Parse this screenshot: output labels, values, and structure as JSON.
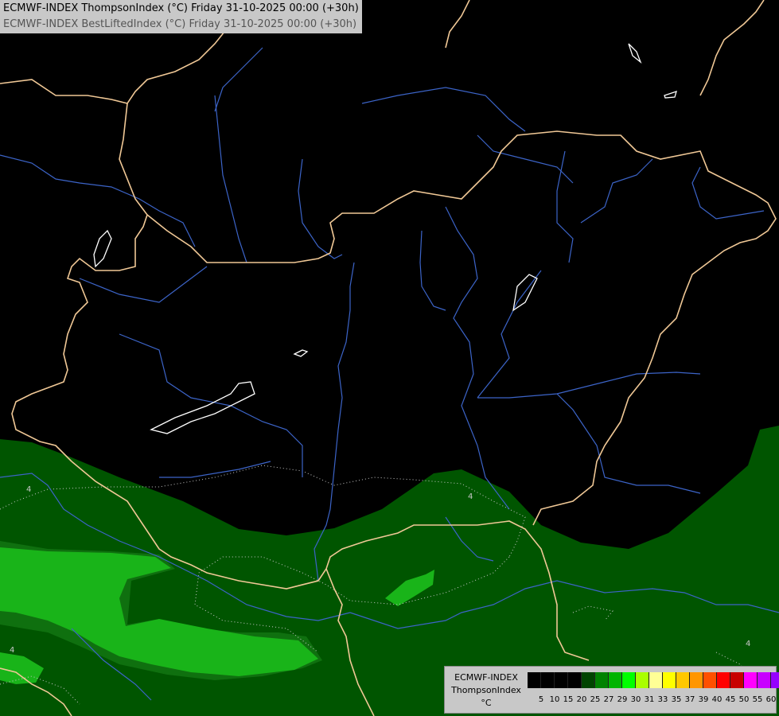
{
  "title": {
    "line1": "ECMWF-INDEX ThompsonIndex (°C) Friday 31-10-2025 00:00 (+30h)",
    "line2": "ECMWF-INDEX BestLiftedIndex (°C) Friday 31-10-2025 00:00 (+30h)"
  },
  "map": {
    "contour_labels": [
      "4",
      "4",
      "4",
      "4"
    ],
    "colors": {
      "background": "#000000",
      "dark_green": "#005500",
      "mid_green": "#008200",
      "bright_green": "#19b419",
      "borders": "#f0c896",
      "rivers": "#3c64c8",
      "lakes": "#ffffff",
      "contours": "#c8c8c8"
    }
  },
  "legend": {
    "line1": "ECMWF-INDEX",
    "line2": "ThompsonIndex",
    "line3": "°C",
    "swatch_colors": [
      "#000000",
      "#000000",
      "#000000",
      "#000000",
      "#004400",
      "#008200",
      "#00b400",
      "#00ff00",
      "#aaff00",
      "#ffff96",
      "#ffff00",
      "#ffc800",
      "#ff9600",
      "#ff5000",
      "#ff0000",
      "#c80000",
      "#ff00ff",
      "#c800ff",
      "#9600ff",
      "#6400ff",
      "#0000ff"
    ],
    "ticks": [
      "5",
      "10",
      "15",
      "20",
      "25",
      "27",
      "29",
      "30",
      "31",
      "33",
      "35",
      "37",
      "39",
      "40",
      "45",
      "50",
      "55",
      "60"
    ]
  }
}
